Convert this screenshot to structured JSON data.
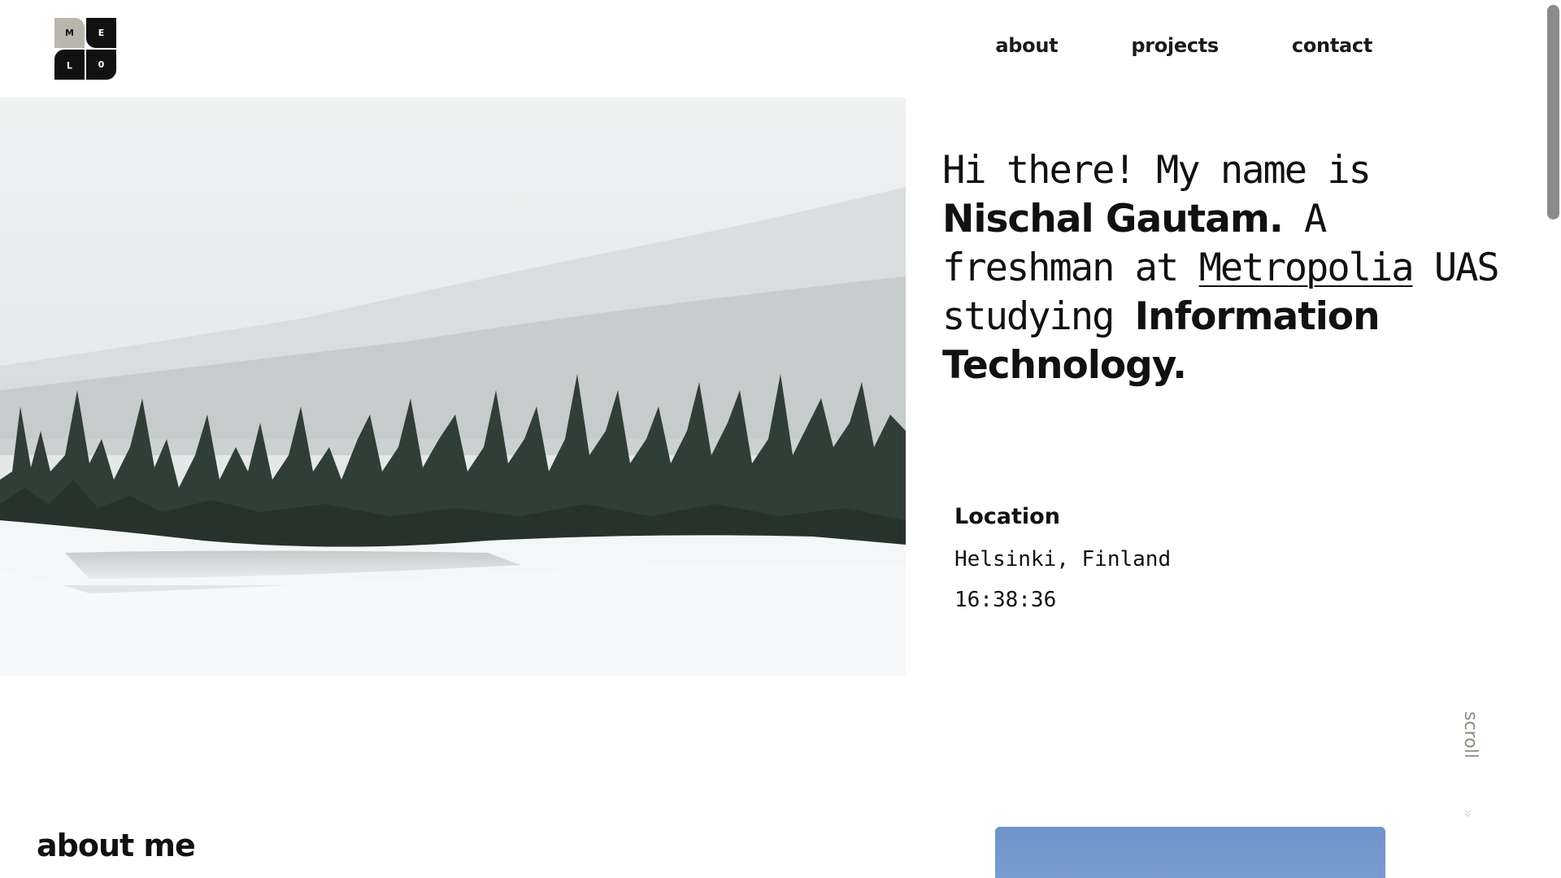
{
  "logo": {
    "letters": [
      "M",
      "E",
      "ᒣ",
      "0"
    ]
  },
  "nav": {
    "items": [
      {
        "label": "about"
      },
      {
        "label": "projects"
      },
      {
        "label": "contact"
      }
    ]
  },
  "hero": {
    "image_alt": "snowy-forest-lake-icon",
    "intro": {
      "part1": "Hi there! My name is ",
      "name": "Nischal Gautam.",
      "part2": " A freshman at ",
      "school_link": "Metropolia",
      "part3": " UAS studying ",
      "field": "Information Technology."
    }
  },
  "location": {
    "heading": "Location",
    "city": "Helsinki, Finland",
    "time": "16:38:36"
  },
  "scroll": {
    "label": "scroll",
    "icon": "chevron-down-icon"
  },
  "about": {
    "title": "about me"
  },
  "colors": {
    "accent_gray": "#b9b7ab",
    "text": "#111111",
    "scroll_label": "#8a8c7d"
  }
}
